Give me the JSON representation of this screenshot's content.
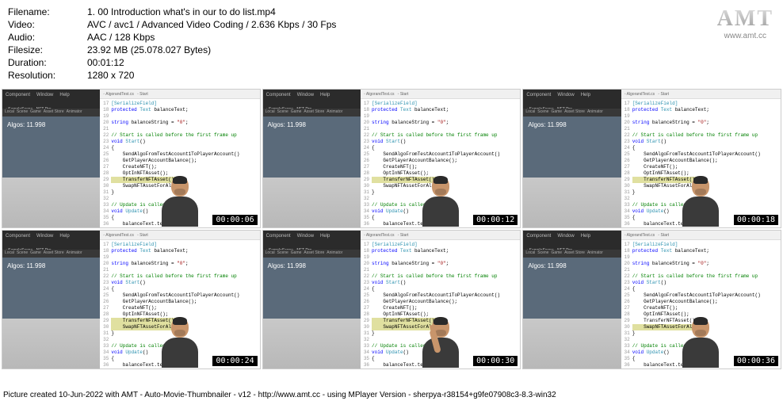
{
  "metadata": {
    "filename_label": "Filename:",
    "filename": "1. 00 Introduction what's in our to do list.mp4",
    "video_label": "Video:",
    "video": "AVC / avc1 / Advanced Video Coding / 2.636 Kbps / 30 Fps",
    "audio_label": "Audio:",
    "audio": "AAC / 128 Kbps",
    "filesize_label": "Filesize:",
    "filesize": "23.92 MB (25.078.027 Bytes)",
    "duration_label": "Duration:",
    "duration": "00:01:12",
    "resolution_label": "Resolution:",
    "resolution": "1280 x 720"
  },
  "logo": {
    "text": "AMT",
    "url": "www.amt.cc"
  },
  "unity": {
    "menu": [
      "Component",
      "Window",
      "Help"
    ],
    "tab": "SampleScene - NFT Pro",
    "toolbar": [
      "Local",
      "Scene",
      "Game",
      "Asset Store",
      "Animator"
    ],
    "algos": "Algos: 11.998"
  },
  "code_tab": "AlgorandTest.cs",
  "timestamps": [
    "00:00:06",
    "00:00:12",
    "00:00:18",
    "00:00:24",
    "00:00:30",
    "00:00:36"
  ],
  "code_variants": [
    {
      "lines": [
        "SendAlgoFromTestAccount1ToPlayerAccount()",
        "GetPlayerAccountBalance();",
        "CreateNFT();",
        "OptInNFTAsset();",
        "TransferNFTAsset();",
        "SwapNFTAssetForAlgo"
      ],
      "hl": [
        4
      ]
    },
    {
      "lines": [
        "SendAlgoFromTestAccount1ToPlayerAccount()",
        "GetPlayerAccountBalance();",
        "CreateNFT();",
        "OptInNFTAsset();",
        "TransferNFTAsset();",
        "SwapNFTAssetForAlgo"
      ],
      "hl": [
        4
      ]
    },
    {
      "lines": [
        "SendAlgoFromTestAccount1ToPlayerAccount()",
        "GetPlayerAccountBalance();",
        "CreateNFT();",
        "OptInNFTAsset();",
        "TransferNFTAsset();",
        "SwapNFTAssetForAlgo"
      ],
      "hl": [
        4
      ]
    },
    {
      "lines": [
        "SendAlgoFromTestAccount1ToPlayerAccount()",
        "GetPlayerAccountBalance();",
        "CreateNFT();",
        "OptInNFTAsset();",
        "TransferNFTAsset();",
        "SwapNFTAssetForAlgo"
      ],
      "hl": [
        4,
        5
      ]
    },
    {
      "lines": [
        "SendAlgoFromTestAccount1ToPlayerAccount()",
        "GetPlayerAccountBalance();",
        "CreateNFT();",
        "OptInNFTAsset();",
        "TransferNFTAsset();",
        "SwapNFTAssetForAlgo"
      ],
      "hl": [
        4,
        5
      ]
    },
    {
      "lines": [
        "SendAlgoFromTestAccount1ToPlayerAccount()",
        "GetPlayerAccountBalance();",
        "CreateNFT();",
        "OptInNFTAsset();",
        "TransferNFTAsset();",
        "SwapNFTAssetForAlgo"
      ],
      "hl": [
        5
      ]
    }
  ],
  "arm_up": [
    false,
    false,
    false,
    false,
    true,
    false
  ],
  "code_common": {
    "attr": "[SerializeField]",
    "decl1": "protected Text balanceText;",
    "decl2_pre": "string balanceString = ",
    "decl2_str": "\"0\"",
    "decl2_post": ";",
    "comment1": "// Start is called before the first frame up",
    "start": "void Start()",
    "comment2": "// Update is called on",
    "update": "void Update()",
    "balance": "balanceText.text"
  },
  "footer": "Picture created 10-Jun-2022 with AMT - Auto-Movie-Thumbnailer - v12 - http://www.amt.cc - using MPlayer Version - sherpya-r38154+g9fe07908c3-8.3-win32"
}
